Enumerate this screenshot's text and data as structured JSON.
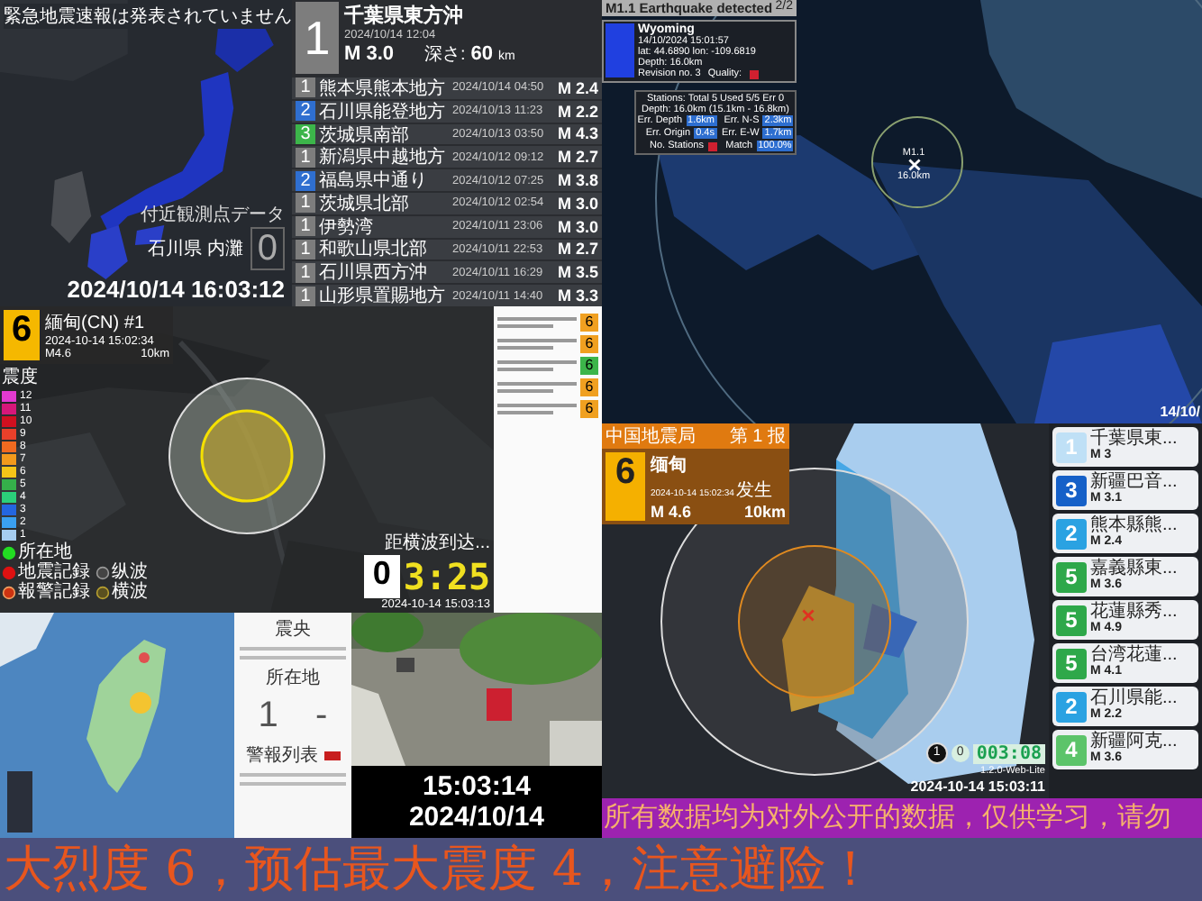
{
  "japan_panel": {
    "notice": "緊急地震速報は発表されていません",
    "latest": {
      "intensity": "1",
      "color": "#7d7d7d",
      "place": "千葉県東方沖",
      "time": "2024/10/14 12:04",
      "magnitude": "M 3.0",
      "depth_label": "深さ:",
      "depth": "60",
      "depth_unit": "km"
    },
    "history": [
      {
        "intensity": "1",
        "color": "#7d7d7d",
        "place": "熊本県熊本地方",
        "time": "2024/10/14 04:50",
        "magnitude": "M 2.4"
      },
      {
        "intensity": "2",
        "color": "#2f6fd0",
        "place": "石川県能登地方",
        "time": "2024/10/13 11:23",
        "magnitude": "M 2.2"
      },
      {
        "intensity": "3",
        "color": "#3cb54a",
        "place": "茨城県南部",
        "time": "2024/10/13 03:50",
        "magnitude": "M 4.3"
      },
      {
        "intensity": "1",
        "color": "#7d7d7d",
        "place": "新潟県中越地方",
        "time": "2024/10/12 09:12",
        "magnitude": "M 2.7"
      },
      {
        "intensity": "2",
        "color": "#2f6fd0",
        "place": "福島県中通り",
        "time": "2024/10/12 07:25",
        "magnitude": "M 3.8"
      },
      {
        "intensity": "1",
        "color": "#7d7d7d",
        "place": "茨城県北部",
        "time": "2024/10/12 02:54",
        "magnitude": "M 3.0"
      },
      {
        "intensity": "1",
        "color": "#7d7d7d",
        "place": "伊勢湾",
        "time": "2024/10/11 23:06",
        "magnitude": "M 3.0"
      },
      {
        "intensity": "1",
        "color": "#7d7d7d",
        "place": "和歌山県北部",
        "time": "2024/10/11 22:53",
        "magnitude": "M 2.7"
      },
      {
        "intensity": "1",
        "color": "#7d7d7d",
        "place": "石川県西方沖",
        "time": "2024/10/11 16:29",
        "magnitude": "M 3.5"
      },
      {
        "intensity": "1",
        "color": "#7d7d7d",
        "place": "山形県置賜地方",
        "time": "2024/10/11 14:40",
        "magnitude": "M 3.3"
      }
    ],
    "station": {
      "title": "付近観測点データ",
      "name": "石川県 内灘",
      "intensity": "0"
    },
    "clock": "2024/10/14 16:03:12"
  },
  "global_panel": {
    "title": "M1.1 Earthquake detected",
    "page": "2/2",
    "region": "Wyoming",
    "time": "14/10/2024 15:01:57",
    "coords": "lat: 44.6890 lon: -109.6819",
    "depth": "Depth: 16.0km",
    "revision": "Revision no. 3",
    "quality_label": "Quality:",
    "summary": [
      "Stations: Total 5 Used 5/5 Err 0",
      "Depth: 16.0km (15.1km - 16.8km)"
    ],
    "stats": [
      {
        "label": "Err. Depth",
        "kind": "value",
        "value": "1.6km"
      },
      {
        "label": "Err. N-S",
        "kind": "value",
        "value": "2.3km"
      },
      {
        "label": "Err. Origin",
        "kind": "value",
        "value": "0.4s"
      },
      {
        "label": "Err. E-W",
        "kind": "value",
        "value": "1.7km"
      },
      {
        "label": "No. Stations",
        "kind": "flag"
      },
      {
        "label": "Match",
        "kind": "value",
        "value": "100.0%"
      }
    ],
    "marker": {
      "magnitude": "M1.1",
      "depth": "16.0km"
    },
    "clock": "14/10/"
  },
  "regional_panel": {
    "intensity": "6",
    "title": "緬甸(CN) #1",
    "time": "2024-10-14 15:02:34",
    "magnitude": "M4.6",
    "depth": "10km",
    "legend_title": "震度",
    "legend": [
      {
        "label": "12",
        "color": "#e23ad0"
      },
      {
        "label": "11",
        "color": "#d6177a"
      },
      {
        "label": "10",
        "color": "#d01020"
      },
      {
        "label": "9",
        "color": "#e8402a"
      },
      {
        "label": "8",
        "color": "#f06a20"
      },
      {
        "label": "7",
        "color": "#f39a1c"
      },
      {
        "label": "6",
        "color": "#f5c518"
      },
      {
        "label": "5",
        "color": "#35b04a"
      },
      {
        "label": "4",
        "color": "#2bd07a"
      },
      {
        "label": "3",
        "color": "#2466e0"
      },
      {
        "label": "2",
        "color": "#3aa0f0"
      },
      {
        "label": "1",
        "color": "#a6cdf0"
      }
    ],
    "markers": [
      {
        "label": "所在地",
        "kind": "here"
      },
      {
        "label": "地震記録",
        "kind": "quake"
      },
      {
        "label": "纵波",
        "kind": "p"
      },
      {
        "label": "報警記録",
        "kind": "alarm"
      },
      {
        "label": "横波",
        "kind": "s"
      }
    ],
    "countdown": {
      "caption": "距横波到达...",
      "digit": "0",
      "time": "3:25",
      "clock": "2024-10-14 15:03:13"
    },
    "side_list": [
      {
        "intensity": "6",
        "color": "#f0a020"
      },
      {
        "intensity": "6",
        "color": "#f0a020"
      },
      {
        "intensity": "6",
        "color": "#3cb54a"
      },
      {
        "intensity": "6",
        "color": "#f0a020"
      },
      {
        "intensity": "6",
        "color": "#f0a020"
      }
    ]
  },
  "china_panel": {
    "agency": "中国地震局",
    "report": "第 1 报",
    "intensity": "6",
    "place": "缅甸",
    "time": "2024-10-14 15:02:34",
    "time_suffix": "发生",
    "magnitude": "M 4.6",
    "depth": "10km",
    "timer": {
      "count": "1",
      "zero": "0",
      "time": "003:08"
    },
    "version": "1.2.0-Web-Lite",
    "clock": "2024-10-14 15:03:11",
    "list": [
      {
        "intensity": "1",
        "color": "#bfe0f6",
        "place": "千葉県東...",
        "magnitude": "M 3"
      },
      {
        "intensity": "3",
        "color": "#1560c8",
        "place": "新疆巴音...",
        "magnitude": "M 3.1"
      },
      {
        "intensity": "2",
        "color": "#2aa2e2",
        "place": "熊本縣熊...",
        "magnitude": "M 2.4"
      },
      {
        "intensity": "5",
        "color": "#2ea84a",
        "place": "嘉義縣東...",
        "magnitude": "M 3.6"
      },
      {
        "intensity": "5",
        "color": "#2ea84a",
        "place": "花蓮縣秀...",
        "magnitude": "M 4.9"
      },
      {
        "intensity": "5",
        "color": "#2ea84a",
        "place": "台湾花蓮...",
        "magnitude": "M 4.1"
      },
      {
        "intensity": "2",
        "color": "#2aa2e2",
        "place": "石川県能...",
        "magnitude": "M 2.2"
      },
      {
        "intensity": "4",
        "color": "#5cc46a",
        "place": "新疆阿克...",
        "magnitude": "M 3.6"
      }
    ]
  },
  "taiwan_panel": {
    "epicenter_title": "震央",
    "location_title": "所在地",
    "local_intensity": "1",
    "arrival": "-",
    "alarm_title": "警報列表"
  },
  "camera_panel": {
    "time": "15:03:14",
    "date": "2024/10/14"
  },
  "banner": "所有数据均为对外公开的数据，仅供学习，请勿",
  "ticker": "大烈度 6，预估最大震度 4，注意避险！"
}
